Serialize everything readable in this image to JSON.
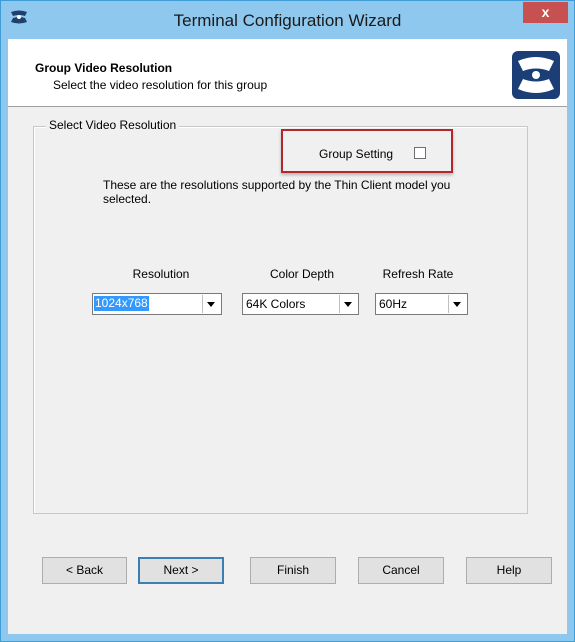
{
  "window": {
    "title": "Terminal Configuration Wizard",
    "close_label": "x",
    "frame_color": "#8fc8ee",
    "close_color": "#c75050",
    "app_icon": "app-icon"
  },
  "header": {
    "title": "Group Video Resolution",
    "subtitle": "Select the video resolution for this group",
    "logo_icon": "thinmanager-logo-icon"
  },
  "group_box": {
    "legend": "Select Video Resolution"
  },
  "group_setting": {
    "label": "Group Setting",
    "checked": false,
    "highlight_color": "#b3262c"
  },
  "info_text": "These are the resolutions supported by the Thin Client model you selected.",
  "fields": {
    "resolution": {
      "label": "Resolution",
      "value": "1024x768"
    },
    "color_depth": {
      "label": "Color Depth",
      "value": "64K Colors"
    },
    "refresh_rate": {
      "label": "Refresh Rate",
      "value": "60Hz"
    }
  },
  "buttons": {
    "back": "< Back",
    "next": "Next >",
    "finish": "Finish",
    "cancel": "Cancel",
    "help": "Help"
  }
}
